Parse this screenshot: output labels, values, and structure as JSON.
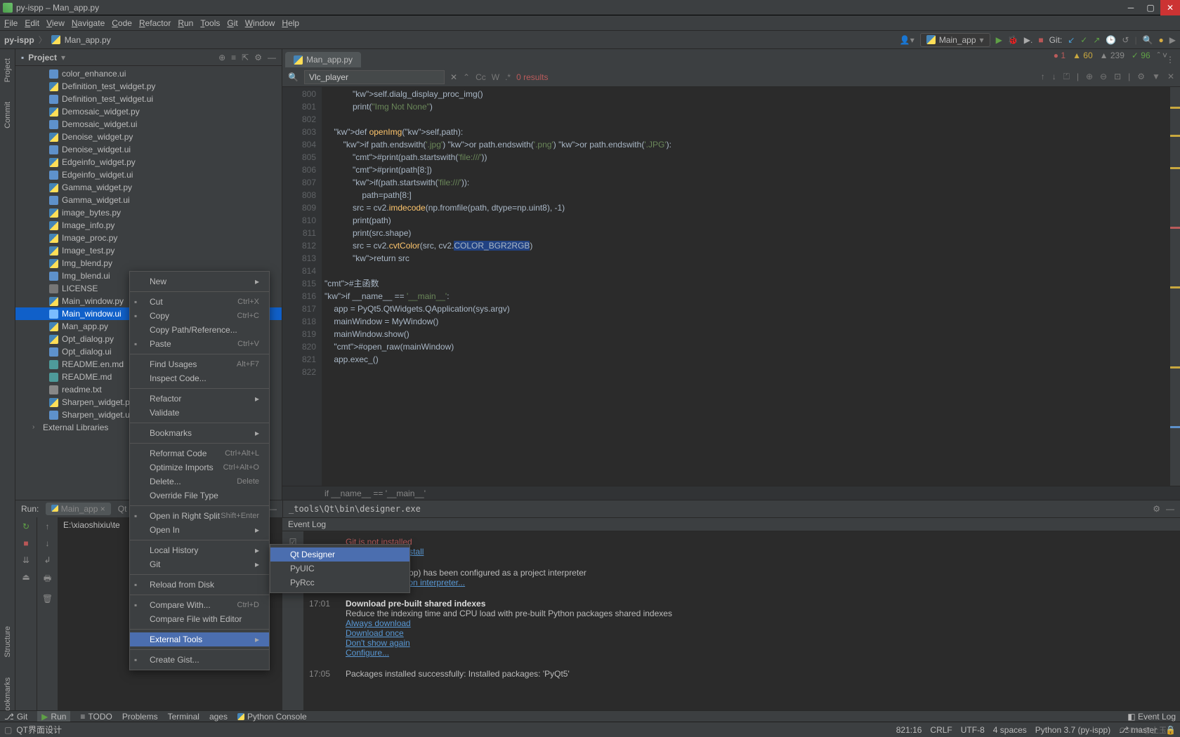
{
  "window": {
    "title": "py-ispp – Man_app.py"
  },
  "menu": [
    "File",
    "Edit",
    "View",
    "Navigate",
    "Code",
    "Refactor",
    "Run",
    "Tools",
    "Git",
    "Window",
    "Help"
  ],
  "breadcrumb": {
    "root": "py-ispp",
    "file": "Man_app.py"
  },
  "run_config": "Main_app",
  "git_label": "Git:",
  "project": {
    "title": "Project",
    "files": [
      {
        "name": "color_enhance.ui",
        "t": "ui"
      },
      {
        "name": "Definition_test_widget.py",
        "t": "py"
      },
      {
        "name": "Definition_test_widget.ui",
        "t": "ui"
      },
      {
        "name": "Demosaic_widget.py",
        "t": "py"
      },
      {
        "name": "Demosaic_widget.ui",
        "t": "ui"
      },
      {
        "name": "Denoise_widget.py",
        "t": "py"
      },
      {
        "name": "Denoise_widget.ui",
        "t": "ui"
      },
      {
        "name": "Edgeinfo_widget.py",
        "t": "py"
      },
      {
        "name": "Edgeinfo_widget.ui",
        "t": "ui"
      },
      {
        "name": "Gamma_widget.py",
        "t": "py"
      },
      {
        "name": "Gamma_widget.ui",
        "t": "ui"
      },
      {
        "name": "image_bytes.py",
        "t": "py"
      },
      {
        "name": "Image_info.py",
        "t": "py"
      },
      {
        "name": "Image_proc.py",
        "t": "py"
      },
      {
        "name": "Image_test.py",
        "t": "py"
      },
      {
        "name": "Img_blend.py",
        "t": "py"
      },
      {
        "name": "Img_blend.ui",
        "t": "ui"
      },
      {
        "name": "LICENSE",
        "t": "lic"
      },
      {
        "name": "Main_window.py",
        "t": "py"
      },
      {
        "name": "Main_window.ui",
        "t": "ui",
        "sel": true
      },
      {
        "name": "Man_app.py",
        "t": "py"
      },
      {
        "name": "Opt_dialog.py",
        "t": "py"
      },
      {
        "name": "Opt_dialog.ui",
        "t": "ui"
      },
      {
        "name": "README.en.md",
        "t": "md"
      },
      {
        "name": "README.md",
        "t": "md"
      },
      {
        "name": "readme.txt",
        "t": "txt"
      },
      {
        "name": "Sharpen_widget.py",
        "t": "py"
      },
      {
        "name": "Sharpen_widget.ui",
        "t": "ui"
      }
    ],
    "extlib": "External Libraries"
  },
  "tab": {
    "name": "Man_app.py"
  },
  "find": {
    "query": "Vlc_player",
    "results": "0 results"
  },
  "code": {
    "start": 800,
    "lines": [
      "            self.dialg_display_proc_img()",
      "            print(\"Img Not None\")",
      "",
      "    def openImg(self,path):",
      "        if path.endswith('.jpg') or path.endswith('.png') or path.endswith('.JPG'):",
      "            #print(path.startswith('file:///'))",
      "            #print(path[8:])",
      "            if(path.startswith('file:///')):",
      "                path=path[8:]",
      "            src = cv2.imdecode(np.fromfile(path, dtype=np.uint8), -1)",
      "            print(path)",
      "            print(src.shape)",
      "            src = cv2.cvtColor(src, cv2.COLOR_BGR2RGB)",
      "            return src",
      "",
      "#主函数",
      "if __name__ == '__main__':",
      "    app = PyQt5.QtWidgets.QApplication(sys.argv)",
      "    mainWindow = MyWindow()",
      "    mainWindow.show()",
      "    #open_raw(mainWindow)",
      "    app.exec_()",
      ""
    ],
    "breadcrumb": "if __name__ == '__main__'"
  },
  "badges": {
    "errors": "1",
    "warnings": "60",
    "typos": "239",
    "ok": "96"
  },
  "run": {
    "title": "Run:",
    "tab": "Main_app",
    "qt_tab": "Qt",
    "output": "E:\\xiaoshixiu\\te",
    "tools_path": "_tools\\Qt\\bin\\designer.exe"
  },
  "eventlog": {
    "title": "Event Log",
    "items": [
      {
        "t": "",
        "head": "Git is not installed",
        "head_class": "red",
        "links": [
          "Download and Install"
        ]
      },
      {
        "t": "17:01",
        "text": "Python 3.7 (py-ispp) has been configured as a project interpreter",
        "links": [
          "Configure a Python interpreter..."
        ]
      },
      {
        "t": "17:01",
        "bold": "Download pre-built shared indexes",
        "text": "Reduce the indexing time and CPU load with pre-built Python packages shared indexes",
        "links": [
          "Always download",
          "Download once",
          "Don't show again",
          "Configure..."
        ]
      },
      {
        "t": "17:05",
        "text": "Packages installed successfully: Installed packages: 'PyQt5'"
      }
    ]
  },
  "status": {
    "tabs": [
      "Git",
      "Run",
      "TODO",
      "Problems",
      "Terminal",
      "Python Packages",
      "Python Console"
    ],
    "run_sel": "Run",
    "right": {
      "ev": "Event Log"
    }
  },
  "footer": {
    "left": "QT界面设计",
    "pos": "821:16",
    "eol": "CRLF",
    "enc": "UTF-8",
    "indent": "4 spaces",
    "interp": "Python 3.7 (py-ispp)",
    "branch": "master"
  },
  "watermark": "CSDN @上玉尚",
  "context_menu": {
    "items": [
      {
        "l": "New",
        "sub": true
      },
      {
        "sep": true
      },
      {
        "l": "Cut",
        "s": "Ctrl+X",
        "i": "cut"
      },
      {
        "l": "Copy",
        "s": "Ctrl+C",
        "i": "copy"
      },
      {
        "l": "Copy Path/Reference..."
      },
      {
        "l": "Paste",
        "s": "Ctrl+V",
        "i": "paste"
      },
      {
        "sep": true
      },
      {
        "l": "Find Usages",
        "s": "Alt+F7"
      },
      {
        "l": "Inspect Code..."
      },
      {
        "sep": true
      },
      {
        "l": "Refactor",
        "sub": true
      },
      {
        "l": "Validate"
      },
      {
        "sep": true
      },
      {
        "l": "Bookmarks",
        "sub": true
      },
      {
        "sep": true
      },
      {
        "l": "Reformat Code",
        "s": "Ctrl+Alt+L"
      },
      {
        "l": "Optimize Imports",
        "s": "Ctrl+Alt+O"
      },
      {
        "l": "Delete...",
        "s": "Delete"
      },
      {
        "l": "Override File Type"
      },
      {
        "sep": true
      },
      {
        "l": "Open in Right Split",
        "s": "Shift+Enter",
        "i": "split"
      },
      {
        "l": "Open In",
        "sub": true
      },
      {
        "sep": true
      },
      {
        "l": "Local History",
        "sub": true
      },
      {
        "l": "Git",
        "sub": true
      },
      {
        "sep": true
      },
      {
        "l": "Reload from Disk",
        "i": "reload"
      },
      {
        "sep": true
      },
      {
        "l": "Compare With...",
        "s": "Ctrl+D",
        "i": "compare"
      },
      {
        "l": "Compare File with Editor"
      },
      {
        "sep": true
      },
      {
        "l": "External Tools",
        "sub": true,
        "hl": true
      },
      {
        "sep": true
      },
      {
        "l": "Create Gist...",
        "i": "github"
      }
    ],
    "submenu": [
      "Qt Designer",
      "PyUIC",
      "PyRcc"
    ],
    "sub_hl": "Qt Designer"
  }
}
